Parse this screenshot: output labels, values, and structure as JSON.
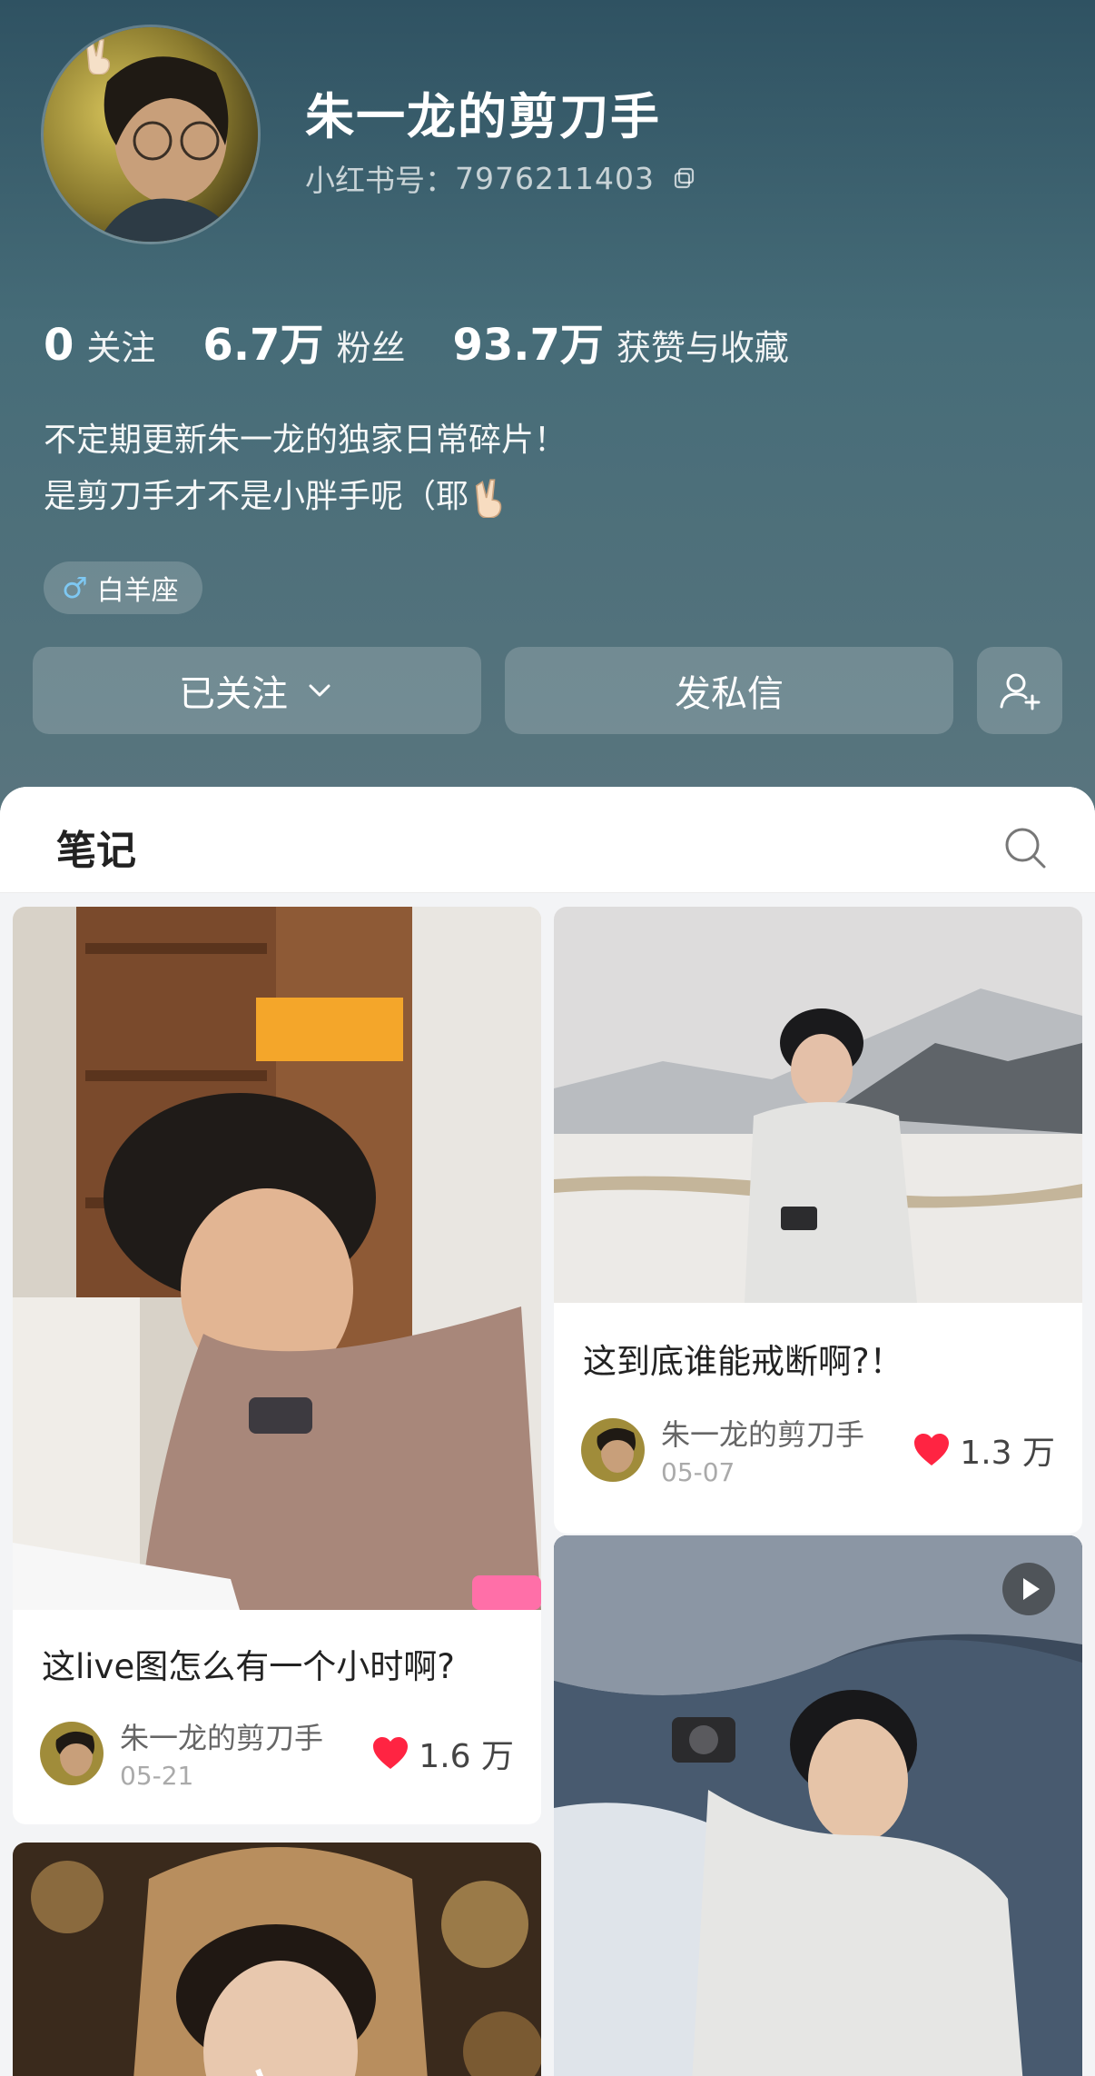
{
  "profile": {
    "name": "朱一龙的剪刀手",
    "id_label": "小红书号：",
    "id_value": "7976211403",
    "avatar_icon": "victory-hand-icon"
  },
  "stats": [
    {
      "num": "0",
      "label": "关注"
    },
    {
      "num": "6.7万",
      "label": "粉丝"
    },
    {
      "num": "93.7万",
      "label": "获赞与收藏"
    }
  ],
  "bio": {
    "line1": "不定期更新朱一龙的独家日常碎片！",
    "line2": "是剪刀手才不是小胖手呢（耶"
  },
  "tag": {
    "icon": "male-icon",
    "label": "白羊座"
  },
  "actions": {
    "follow_label": "已关注",
    "message_label": "发私信",
    "add_user_icon": "add-user-icon"
  },
  "tabs": {
    "notes_label": "笔记",
    "search_icon": "search-icon"
  },
  "notes": [
    {
      "title": "这live图怎么有一个小时啊?",
      "author": "朱一龙的剪刀手",
      "date": "05-21",
      "likes": "1.6 万"
    },
    {
      "title": "这到底谁能戒断啊?！",
      "author": "朱一龙的剪刀手",
      "date": "05-07",
      "likes": "1.3 万"
    },
    {
      "title": "",
      "author": "",
      "date": "",
      "likes": ""
    },
    {
      "title": "",
      "author": "",
      "date": "",
      "likes": ""
    }
  ],
  "colors": {
    "header_top": "#2f5262",
    "header_bottom": "#59757e",
    "heart": "#ff2442",
    "male": "#7ec8f2"
  }
}
